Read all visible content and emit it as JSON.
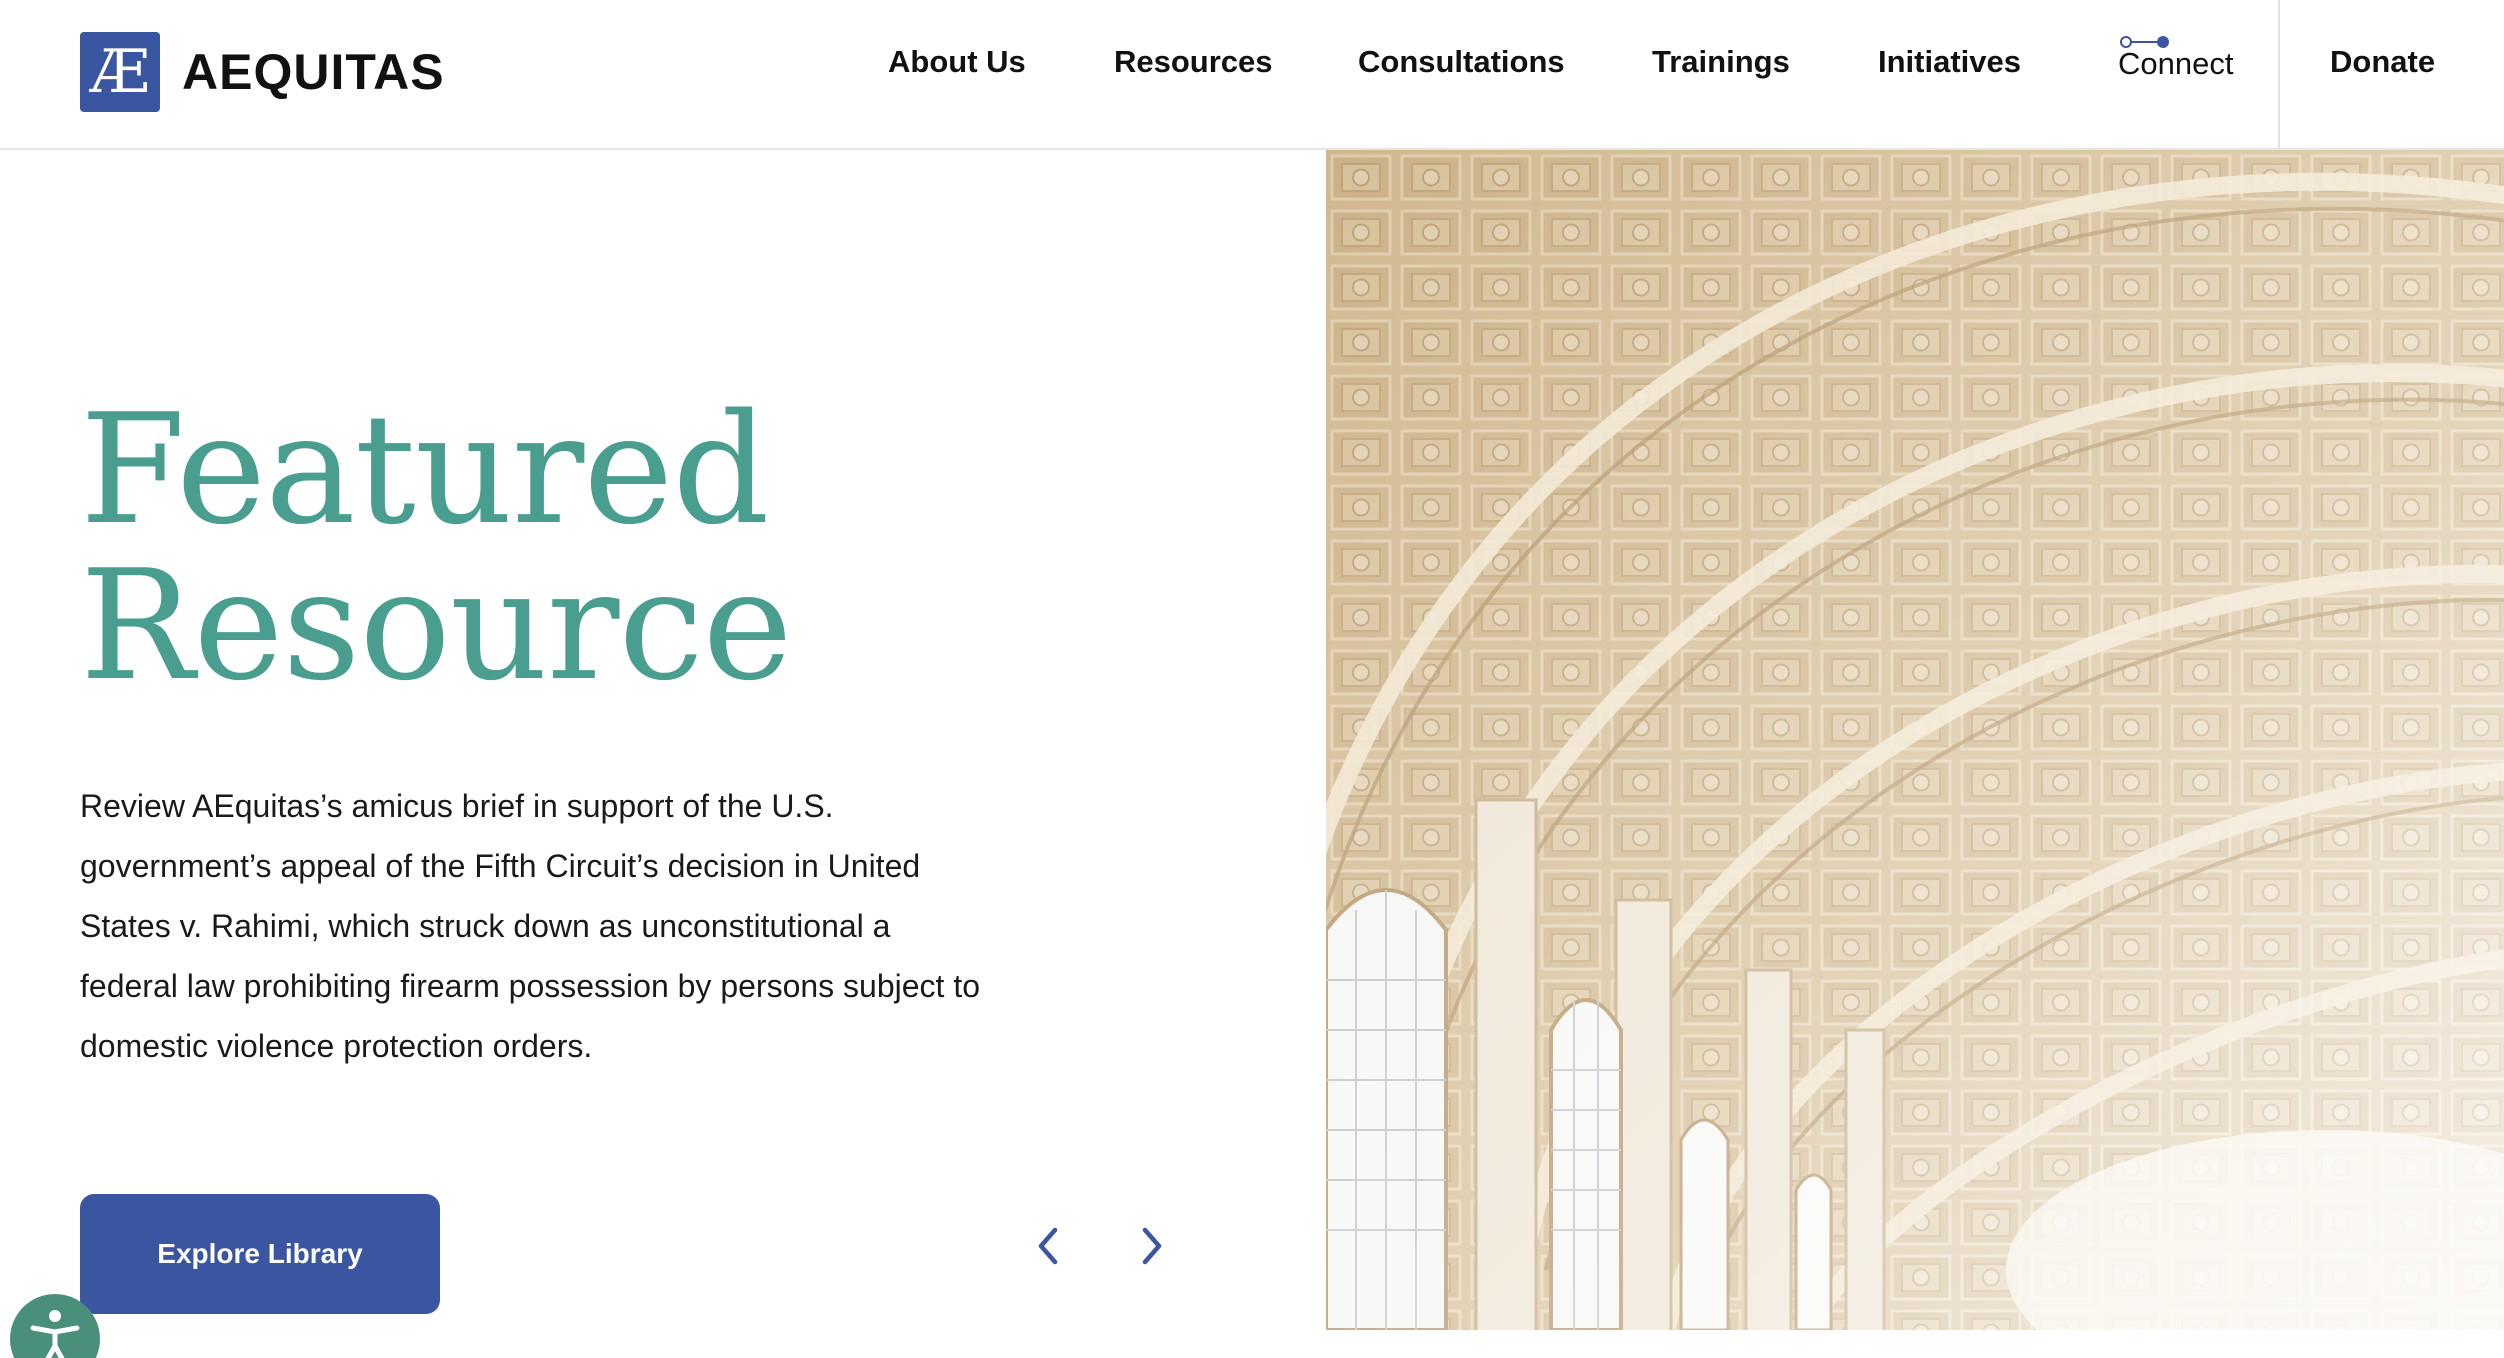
{
  "header": {
    "logo_mark": "Æ",
    "logo_text": "AEQUITAS",
    "nav": [
      {
        "label": "About Us"
      },
      {
        "label": "Resources"
      },
      {
        "label": "Consultations"
      },
      {
        "label": "Trainings"
      },
      {
        "label": "Initiatives"
      },
      {
        "label": "Connect",
        "icon": "connect-icon"
      },
      {
        "label": "Donate"
      }
    ]
  },
  "hero": {
    "title_line1": "Featured",
    "title_line2": "Resource",
    "description": "Review AEquitas’s amicus brief in support of the U.S. government’s appeal of the Fifth Circuit’s decision in United States v. Rahimi, which struck down as unconstitutional a federal law prohibiting firearm possession by persons subject to domestic violence protection orders.",
    "cta_label": "Explore Library",
    "prev_icon": "chevron-left-icon",
    "next_icon": "chevron-right-icon",
    "image": "vaulted-ceiling-photo"
  },
  "accessibility": {
    "icon": "accessibility-icon"
  },
  "colors": {
    "brand_blue": "#3a56a1",
    "accent_teal": "#4a9e8f",
    "accessibility_green": "#4a8f7b"
  }
}
